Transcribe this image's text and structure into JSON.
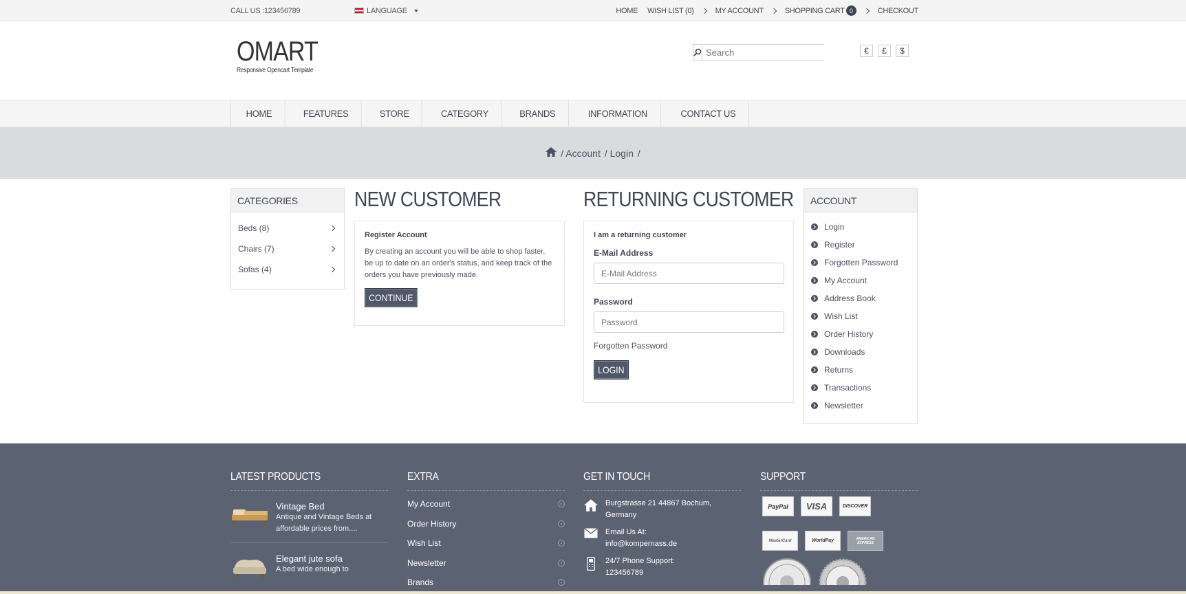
{
  "topbar": {
    "call_us": "CALL US :123456789",
    "language": "LANGUAGE",
    "links": {
      "home": "HOME",
      "wishlist": "WISH LIST (0)",
      "account": "MY ACCOUNT",
      "cart": "SHOPPING CART",
      "cart_count": "0",
      "checkout": "CHECKOUT"
    }
  },
  "header": {
    "logo_name": "OMART",
    "logo_tagline": "Responsive Opencart Template",
    "search_placeholder": "Search",
    "currencies": [
      "€",
      "£",
      "$"
    ]
  },
  "nav": [
    "HOME",
    "FEATURES",
    "STORE",
    "CATEGORY",
    "BRANDS",
    "INFORMATION",
    "CONTACT US"
  ],
  "breadcrumb": [
    "/ Account",
    "/ Login",
    "/"
  ],
  "categories": {
    "title": "CATEGORIES",
    "items": [
      "Beds (8)",
      "Chairs (7)",
      "Sofas (4)"
    ]
  },
  "new_customer": {
    "title": "NEW CUSTOMER",
    "subtitle": "Register Account",
    "text": "By creating an account you will be able to shop faster, be up to date on an order's status, and keep track of the orders you have previously made.",
    "button": "CONTINUE"
  },
  "returning": {
    "title": "RETURNING CUSTOMER",
    "subtitle": "I am a returning customer",
    "email_label": "E-Mail Address",
    "email_placeholder": "E-Mail Address",
    "password_label": "Password",
    "password_placeholder": "Password",
    "forgotten": "Forgotten Password",
    "button": "LOGIN"
  },
  "account": {
    "title": "ACCOUNT",
    "items": [
      "Login",
      "Register",
      "Forgotten Password",
      "My Account",
      "Address Book",
      "Wish List",
      "Order History",
      "Downloads",
      "Returns",
      "Transactions",
      "Newsletter"
    ]
  },
  "footer": {
    "latest_title": "LATEST PRODUCTS",
    "products": [
      {
        "name": "Vintage Bed",
        "desc": "Antique and Vintage Beds at affordable prices from...."
      },
      {
        "name": "Elegant jute sofa",
        "desc": "A bed wide enough to"
      }
    ],
    "extra_title": "EXTRA",
    "extra_items": [
      "My Account",
      "Order History",
      "Wish List",
      "Newsletter",
      "Brands"
    ],
    "contact_title": "GET IN TOUCH",
    "address": "Burgstrasse 21 44867 Bochum, Germany",
    "email_label": "Email Us At:",
    "email": "info@kompernass.de",
    "phone_label": "24/7 Phone Support:",
    "phone": "123456789",
    "support_title": "SUPPORT",
    "cards": [
      "PayPal",
      "VISA",
      "DISCOVER",
      "MasterCard",
      "WorldPay",
      "AMERICAN EXPRESS"
    ]
  },
  "colors": {
    "accent": "#4f5768",
    "footer_bg": "#5b6272",
    "band_bg": "#d9dcdf"
  }
}
